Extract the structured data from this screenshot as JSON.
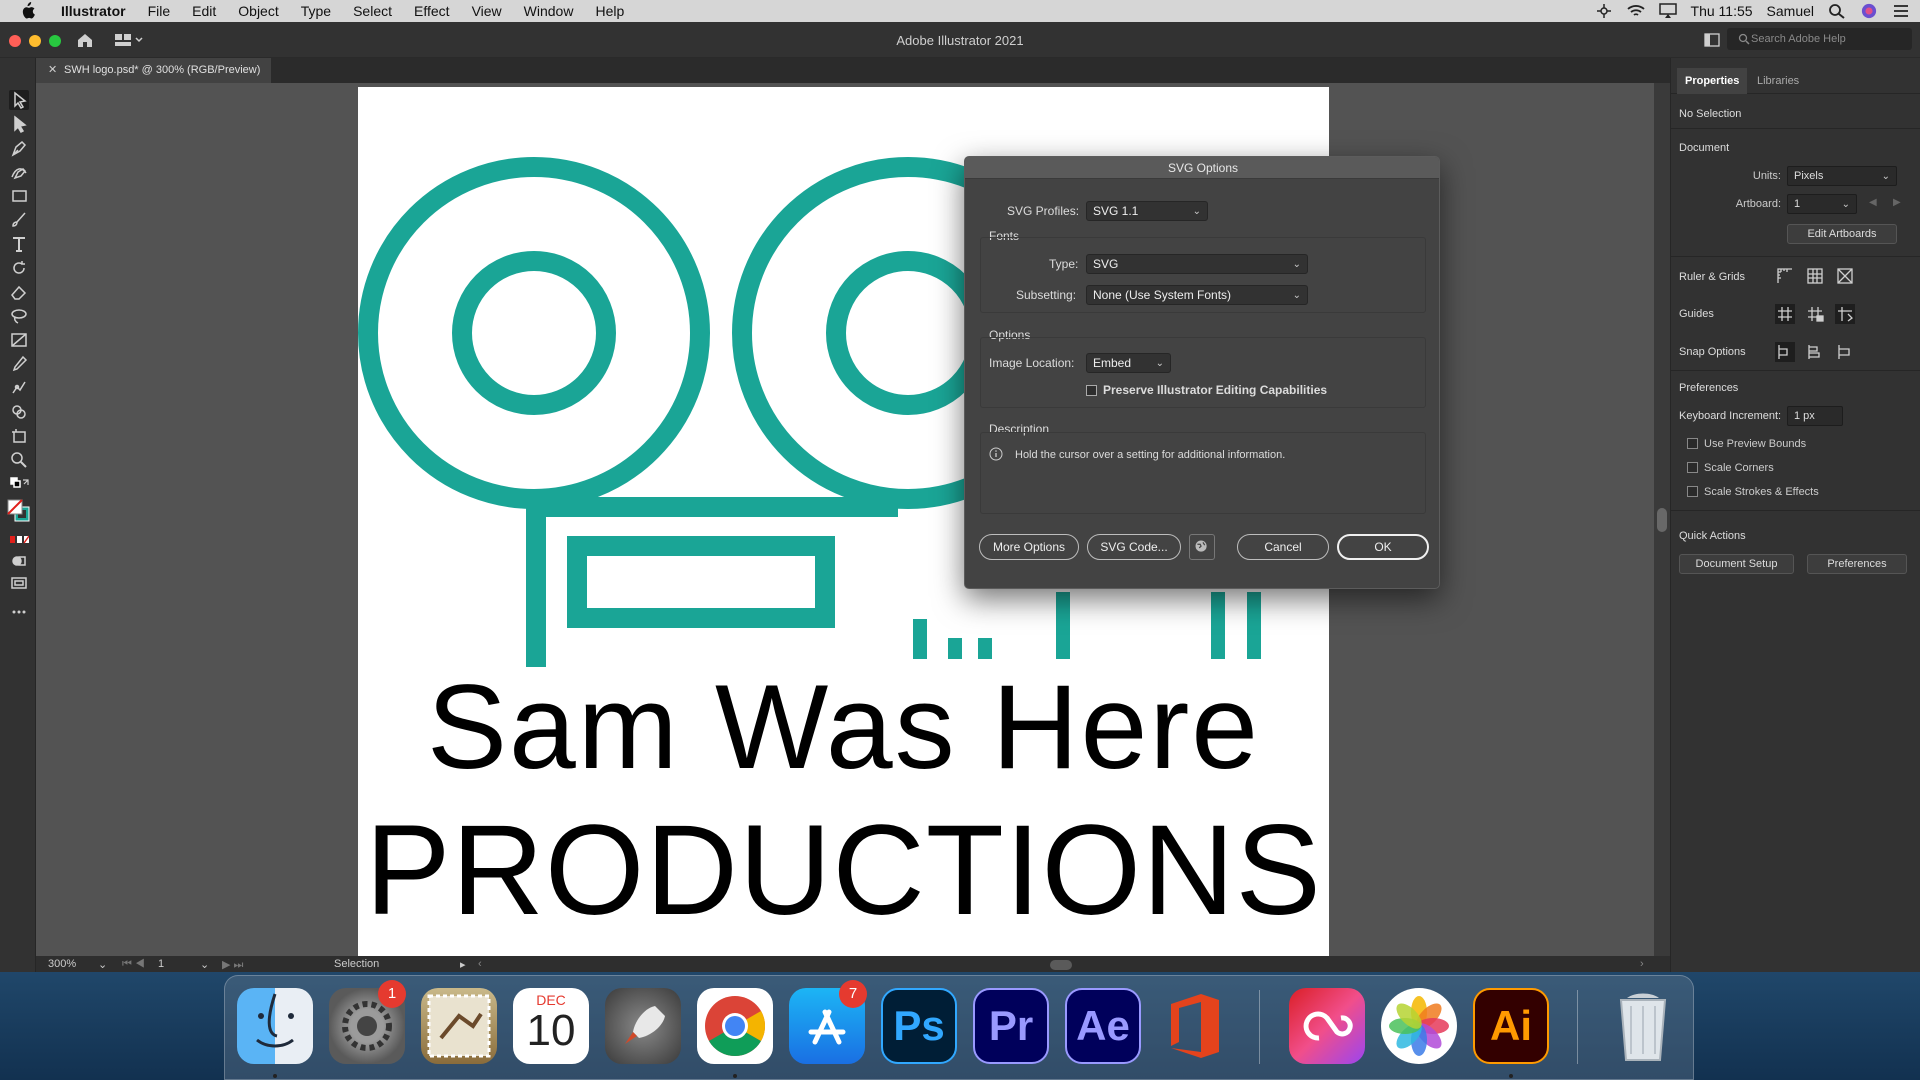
{
  "menubar": {
    "app": "Illustrator",
    "items": [
      "File",
      "Edit",
      "Object",
      "Type",
      "Select",
      "Effect",
      "View",
      "Window",
      "Help"
    ],
    "clock": "Thu 11:55",
    "user": "Samuel"
  },
  "window": {
    "title": "Adobe Illustrator 2021",
    "search_placeholder": "Search Adobe Help"
  },
  "document_tab": {
    "label": "SWH logo.psd* @ 300% (RGB/Preview)"
  },
  "artboard": {
    "line1": "Sam Was Here",
    "line2": "PRODUCTIONS",
    "logo_color": "#1aa596"
  },
  "status_bar": {
    "zoom": "300%",
    "artboard_number": "1",
    "tool": "Selection"
  },
  "right_panel": {
    "tabs": [
      "Properties",
      "Libraries"
    ],
    "selection": "No Selection",
    "document_heading": "Document",
    "units_label": "Units:",
    "units_value": "Pixels",
    "artboard_label": "Artboard:",
    "artboard_value": "1",
    "edit_artboards": "Edit Artboards",
    "ruler_grids": "Ruler & Grids",
    "guides": "Guides",
    "snap_options": "Snap Options",
    "preferences_heading": "Preferences",
    "keyboard_increment_label": "Keyboard Increment:",
    "keyboard_increment_value": "1 px",
    "checkboxes": [
      "Use Preview Bounds",
      "Scale Corners",
      "Scale Strokes & Effects"
    ],
    "quick_actions": "Quick Actions",
    "document_setup": "Document Setup",
    "preferences_button": "Preferences"
  },
  "svg_dialog": {
    "title": "SVG Options",
    "profiles_label": "SVG Profiles:",
    "profiles_value": "SVG 1.1",
    "fonts_heading": "Fonts",
    "type_label": "Type:",
    "type_value": "SVG",
    "subsetting_label": "Subsetting:",
    "subsetting_value": "None (Use System Fonts)",
    "options_heading": "Options",
    "image_location_label": "Image Location:",
    "image_location_value": "Embed",
    "preserve_label": "Preserve Illustrator Editing Capabilities",
    "description_heading": "Description",
    "description_text": "Hold the cursor over a setting for additional information.",
    "more_options": "More Options",
    "svg_code": "SVG Code...",
    "cancel": "Cancel",
    "ok": "OK"
  },
  "dock": {
    "badges": {
      "system_preferences": "1",
      "app_store": "7"
    },
    "calendar_month": "DEC",
    "calendar_day": "10",
    "ps": "Ps",
    "pr": "Pr",
    "ae": "Ae",
    "ai": "Ai"
  }
}
